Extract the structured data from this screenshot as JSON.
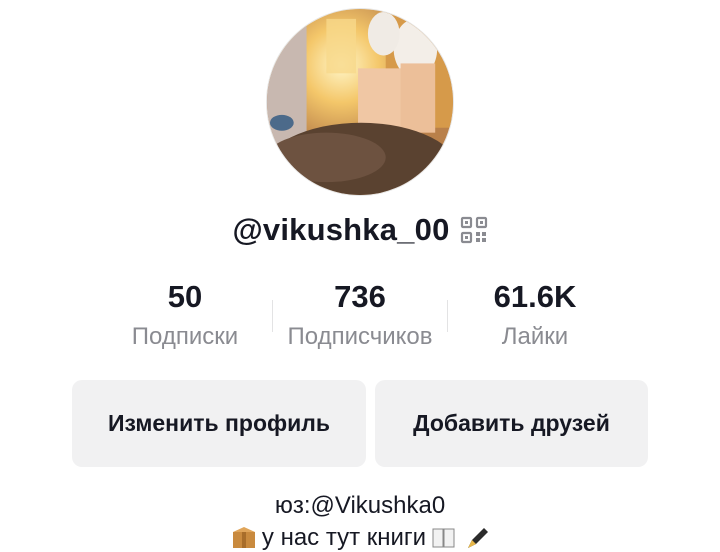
{
  "profile": {
    "username": "@vikushka_00",
    "qr_icon": "qr-code-icon"
  },
  "stats": [
    {
      "value": "50",
      "label": "Подписки"
    },
    {
      "value": "736",
      "label": "Подписчиков"
    },
    {
      "value": "61.6K",
      "label": "Лайки"
    }
  ],
  "actions": {
    "edit_profile": "Изменить профиль",
    "add_friends": "Добавить друзей"
  },
  "bio": {
    "line1": "юз:@Vikushka0",
    "line2": "у нас тут книги"
  },
  "colors": {
    "text_primary": "#161823",
    "text_secondary": "#8a8b91",
    "button_bg": "#f1f1f2"
  }
}
